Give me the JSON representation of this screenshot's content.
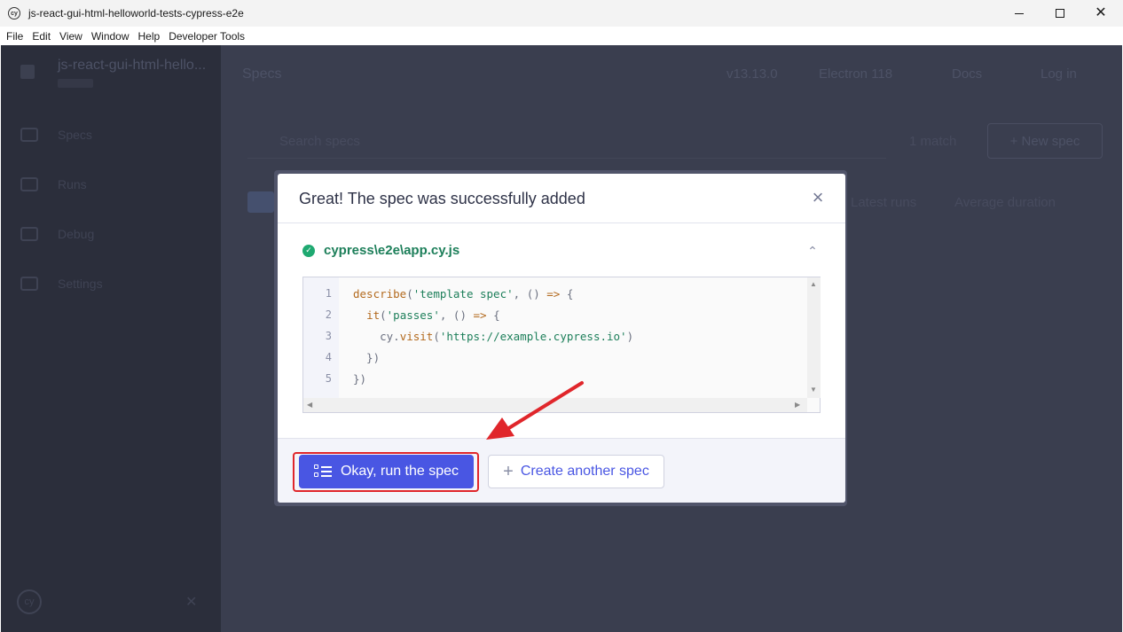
{
  "window": {
    "title": "js-react-gui-html-helloworld-tests-cypress-e2e",
    "icon": "cypress-app-icon",
    "icon_text": "cy"
  },
  "menubar": [
    "File",
    "Edit",
    "View",
    "Window",
    "Help",
    "Developer Tools"
  ],
  "background_app": {
    "project_name": "js-react-gui-html-hello...",
    "nav": [
      "Specs",
      "Runs",
      "Debug",
      "Settings"
    ],
    "page_title": "Specs",
    "header_items": [
      "v13.13.0",
      "Electron 118",
      "Docs",
      "Log in"
    ],
    "search_placeholder": "Search specs",
    "filter_label": "1 match",
    "new_spec_label": "+ New spec",
    "columns": [
      "Latest runs",
      "Average duration"
    ],
    "logo_text": "cy"
  },
  "modal": {
    "title": "Great! The spec was successfully added",
    "file_path": "cypress\\e2e\\app.cy.js",
    "code": {
      "line_numbers": [
        "1",
        "2",
        "3",
        "4",
        "5"
      ],
      "lines": [
        [
          [
            "k",
            "describe"
          ],
          [
            "p",
            "("
          ],
          [
            "s",
            "'template spec'"
          ],
          [
            "p",
            ", () "
          ],
          [
            "k",
            "=>"
          ],
          [
            "p",
            " {"
          ]
        ],
        [
          [
            "p",
            "  "
          ],
          [
            "k",
            "it"
          ],
          [
            "p",
            "("
          ],
          [
            "s",
            "'passes'"
          ],
          [
            "p",
            ", () "
          ],
          [
            "k",
            "=>"
          ],
          [
            "p",
            " {"
          ]
        ],
        [
          [
            "p",
            "    cy."
          ],
          [
            "k",
            "visit"
          ],
          [
            "p",
            "("
          ],
          [
            "s",
            "'https://example.cypress.io'"
          ],
          [
            "p",
            ")"
          ]
        ],
        [
          [
            "p",
            "  })"
          ]
        ],
        [
          [
            "p",
            "})"
          ]
        ]
      ]
    },
    "primary_button": "Okay, run the spec",
    "secondary_button": "Create another spec"
  },
  "annotation": {
    "highlight_color": "#e0262b",
    "arrow_color": "#e0262b"
  }
}
